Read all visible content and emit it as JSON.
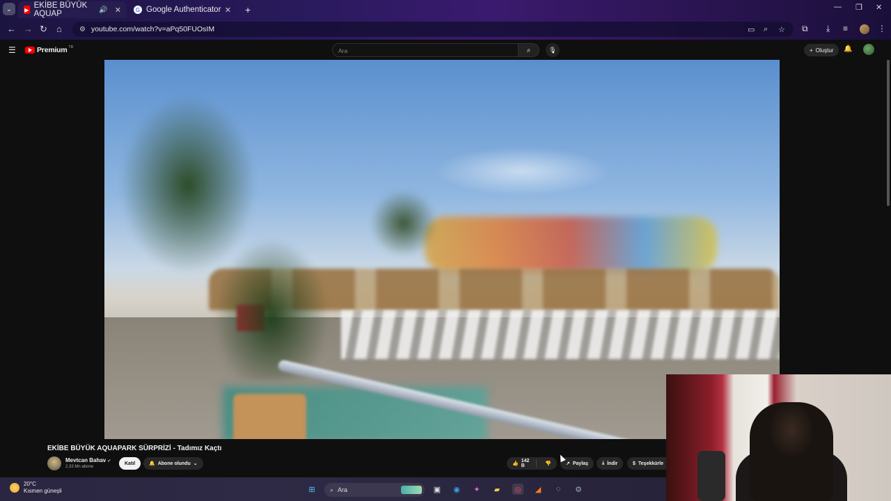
{
  "browser": {
    "tabs": [
      {
        "label": "EKİBE BÜYÜK AQUAP",
        "active": true,
        "favicon": "youtube-icon",
        "audio": true
      },
      {
        "label": "Google Authenticator",
        "active": false,
        "favicon": "google-icon"
      }
    ],
    "url": "youtube.com/watch?v=aPq50FUOsIM"
  },
  "youtube": {
    "brand": "Premium",
    "region": "TR",
    "search_placeholder": "Ara",
    "create_label": "Oluştur"
  },
  "video": {
    "title": "EKİBE BÜYÜK AQUAPARK SÜRPRİZİ - Tadımız Kaçtı",
    "channel": "Mevtcan Bahav",
    "subscribers": "2,33 Mn abone",
    "join_label": "Katıl",
    "subscribed_label": "Abone olundu",
    "likes": "142 B",
    "share_label": "Paylaş",
    "download_label": "İndir",
    "thanks_label": "Teşekkürle"
  },
  "taskbar": {
    "temperature": "20°C",
    "weather": "Kısmen güneşli",
    "search_label": "Ara"
  },
  "colors": {
    "yt_red": "#ff0000",
    "yt_bg": "#0f0f0f",
    "button_bg": "#272727"
  }
}
